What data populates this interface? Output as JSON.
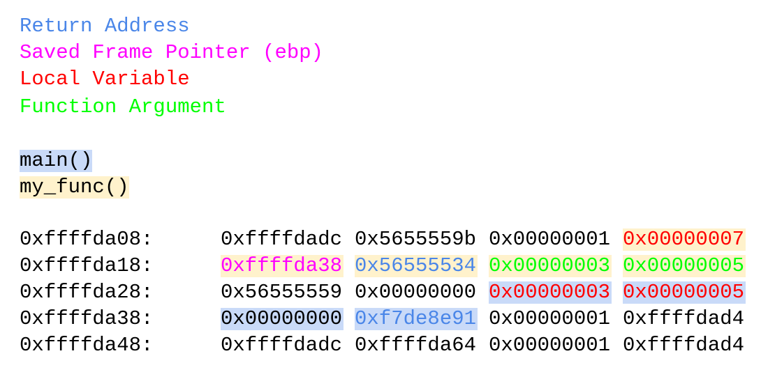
{
  "colors": {
    "return_address": "#4a86e8",
    "saved_frame_pointer": "#ff00ff",
    "local_variable": "#ff0000",
    "function_argument": "#00ff00",
    "plain": "#000000",
    "main_frame_bg": "#c9daf8",
    "my_func_frame_bg": "#fff2cc"
  },
  "legend": [
    {
      "label": "Return Address",
      "kind": "return_address"
    },
    {
      "label": "Saved Frame Pointer (ebp)",
      "kind": "saved_frame_pointer"
    },
    {
      "label": "Local Variable",
      "kind": "local_variable"
    },
    {
      "label": "Function Argument",
      "kind": "function_argument"
    }
  ],
  "frames": [
    {
      "label": "main()",
      "kind": "main_frame_bg"
    },
    {
      "label": "my_func()",
      "kind": "my_func_frame_bg"
    }
  ],
  "memory": [
    {
      "address": "0xffffda08:",
      "words": [
        {
          "value": "0xffffdadc",
          "kind": "plain",
          "frame": null
        },
        {
          "value": "0x5655559b",
          "kind": "plain",
          "frame": null
        },
        {
          "value": "0x00000001",
          "kind": "plain",
          "frame": null
        },
        {
          "value": "0x00000007",
          "kind": "local_variable",
          "frame": "my_func_frame_bg"
        }
      ]
    },
    {
      "address": "0xffffda18:",
      "words": [
        {
          "value": "0xffffda38",
          "kind": "saved_frame_pointer",
          "frame": "my_func_frame_bg"
        },
        {
          "value": "0x56555534",
          "kind": "return_address",
          "frame": "my_func_frame_bg"
        },
        {
          "value": "0x00000003",
          "kind": "function_argument",
          "frame": "my_func_frame_bg"
        },
        {
          "value": "0x00000005",
          "kind": "function_argument",
          "frame": "my_func_frame_bg"
        }
      ]
    },
    {
      "address": "0xffffda28:",
      "words": [
        {
          "value": "0x56555559",
          "kind": "plain",
          "frame": null
        },
        {
          "value": "0x00000000",
          "kind": "plain",
          "frame": null
        },
        {
          "value": "0x00000003",
          "kind": "local_variable",
          "frame": "main_frame_bg"
        },
        {
          "value": "0x00000005",
          "kind": "local_variable",
          "frame": "main_frame_bg"
        }
      ]
    },
    {
      "address": "0xffffda38:",
      "words": [
        {
          "value": "0x00000000",
          "kind": "plain",
          "frame": "main_frame_bg"
        },
        {
          "value": "0xf7de8e91",
          "kind": "return_address",
          "frame": "main_frame_bg"
        },
        {
          "value": "0x00000001",
          "kind": "plain",
          "frame": null
        },
        {
          "value": "0xffffdad4",
          "kind": "plain",
          "frame": null
        }
      ]
    },
    {
      "address": "0xffffda48:",
      "words": [
        {
          "value": "0xffffdadc",
          "kind": "plain",
          "frame": null
        },
        {
          "value": "0xffffda64",
          "kind": "plain",
          "frame": null
        },
        {
          "value": "0x00000001",
          "kind": "plain",
          "frame": null
        },
        {
          "value": "0xffffdad4",
          "kind": "plain",
          "frame": null
        }
      ]
    }
  ]
}
